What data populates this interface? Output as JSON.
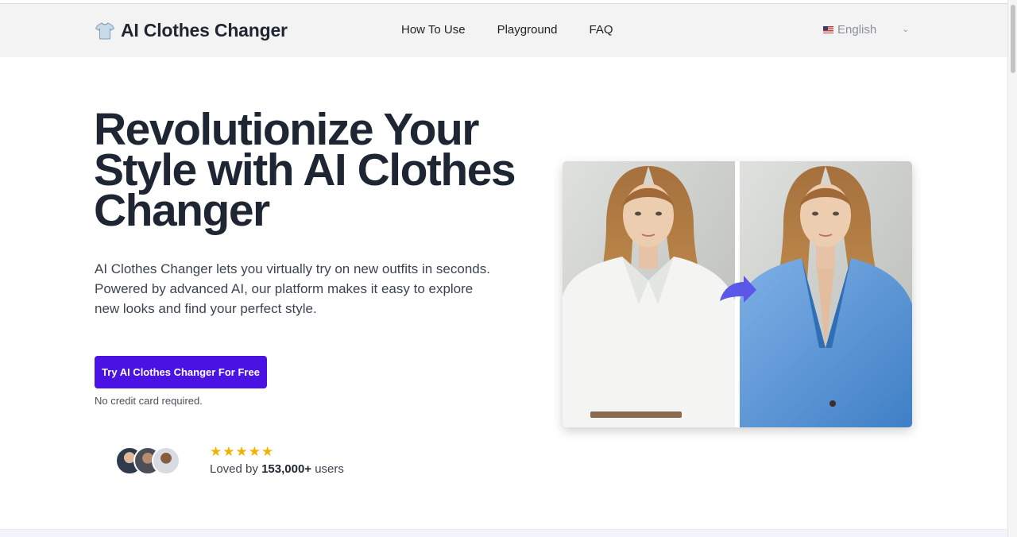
{
  "header": {
    "logo_text": "AI Clothes Changer",
    "logo_icon": "tshirt-icon",
    "nav": [
      {
        "label": "How To Use"
      },
      {
        "label": "Playground"
      },
      {
        "label": "FAQ"
      }
    ],
    "language": {
      "selected": "English",
      "icon": "us-flag-icon"
    }
  },
  "hero": {
    "title": "Revolutionize Your Style with AI Clothes Changer",
    "description": "AI Clothes Changer lets you virtually try on new outfits in seconds. Powered by advanced AI, our platform makes it easy to explore new looks and find your perfect style.",
    "cta_label": "Try AI Clothes Changer For Free",
    "note": "No credit card required.",
    "rating_stars": 5,
    "loved_prefix": "Loved by",
    "loved_count": "153,000+",
    "loved_suffix": "users"
  },
  "colors": {
    "accent": "#4a12e3",
    "star": "#f0b400",
    "arrow": "#5b57e8",
    "header_bg": "#f3f3f3"
  }
}
